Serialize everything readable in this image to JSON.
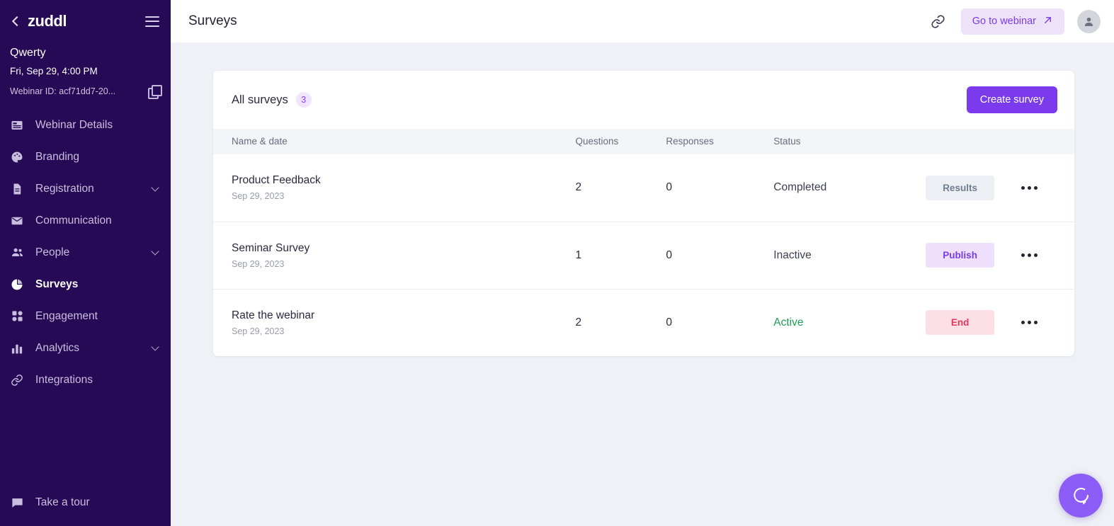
{
  "sidebar": {
    "brand": "zuddl",
    "back_icon": "back-chevron-icon",
    "menu_icon": "hamburger-icon",
    "webinar_name": "Qwerty",
    "webinar_datetime": "Fri, Sep 29, 4:00 PM",
    "webinar_id": "Webinar ID: acf71dd7-20...",
    "copy_icon": "copy-icon",
    "items": [
      {
        "label": "Webinar Details",
        "icon": "webinar-details-icon",
        "active": false,
        "expandable": false
      },
      {
        "label": "Branding",
        "icon": "palette-icon",
        "active": false,
        "expandable": false
      },
      {
        "label": "Registration",
        "icon": "document-icon",
        "active": false,
        "expandable": true
      },
      {
        "label": "Communication",
        "icon": "envelope-icon",
        "active": false,
        "expandable": false
      },
      {
        "label": "People",
        "icon": "people-icon",
        "active": false,
        "expandable": true
      },
      {
        "label": "Surveys",
        "icon": "pie-chart-icon",
        "active": true,
        "expandable": false
      },
      {
        "label": "Engagement",
        "icon": "grid-dots-icon",
        "active": false,
        "expandable": false
      },
      {
        "label": "Analytics",
        "icon": "bar-chart-icon",
        "active": false,
        "expandable": true
      },
      {
        "label": "Integrations",
        "icon": "link-chain-icon",
        "active": false,
        "expandable": false
      }
    ],
    "footer": {
      "label": "Take a tour",
      "icon": "speech-bubble-icon"
    }
  },
  "header": {
    "title": "Surveys",
    "link_icon": "link-chain-icon",
    "go_to_webinar_label": "Go to webinar",
    "go_to_webinar_icon": "arrow-up-right-icon",
    "avatar_icon": "user-avatar-icon"
  },
  "surveys_card": {
    "title": "All surveys",
    "count": "3",
    "create_label": "Create survey",
    "columns": {
      "name": "Name & date",
      "questions": "Questions",
      "responses": "Responses",
      "status": "Status"
    },
    "rows": [
      {
        "name": "Product Feedback",
        "date": "Sep 29, 2023",
        "questions": "2",
        "responses": "0",
        "status": "Completed",
        "status_kind": "completed",
        "action_label": "Results",
        "action_kind": "results",
        "menu_icon": "more-options-icon"
      },
      {
        "name": "Seminar Survey",
        "date": "Sep 29, 2023",
        "questions": "1",
        "responses": "0",
        "status": "Inactive",
        "status_kind": "inactive",
        "action_label": "Publish",
        "action_kind": "publish",
        "menu_icon": "more-options-icon"
      },
      {
        "name": "Rate the webinar",
        "date": "Sep 29, 2023",
        "questions": "2",
        "responses": "0",
        "status": "Active",
        "status_kind": "active",
        "action_label": "End",
        "action_kind": "end",
        "menu_icon": "more-options-icon"
      }
    ]
  },
  "chat_widget": {
    "icon": "chat-bubble-icon"
  },
  "colors": {
    "sidebar_bg": "#260a55",
    "accent_purple": "#7c3aed",
    "page_bg": "#eff1f6",
    "active_green": "#1e9e56",
    "end_red": "#e8365d"
  }
}
